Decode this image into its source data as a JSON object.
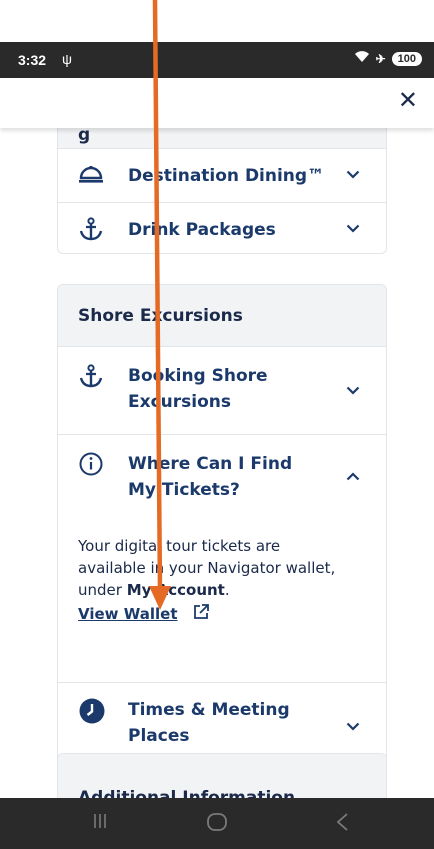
{
  "status_bar": {
    "time": "3:32",
    "usb_icon": "usb-icon",
    "wifi_icon": "wifi-icon",
    "airplane_icon": "airplane-icon",
    "battery": "100"
  },
  "header": {
    "close_icon": "close-icon"
  },
  "sections": {
    "dining": {
      "title_partial": "g",
      "items": [
        {
          "label": "Destination Dining™",
          "icon": "cloche-icon"
        },
        {
          "label": "Drink Packages",
          "icon": "anchor-icon"
        }
      ]
    },
    "shore_excursions": {
      "title": "Shore Excursions",
      "items": [
        {
          "label_line1": "Booking Shore",
          "label_line2": "Excursions",
          "icon": "anchor-icon"
        },
        {
          "label_line1": "Where Can I Find",
          "label_line2": "My Tickets?",
          "icon": "info-icon"
        },
        {
          "label_line1": "Times & Meeting",
          "label_line2": "Places",
          "icon": "clock-icon"
        }
      ],
      "faq_answer": {
        "line1": "Your digital tour tickets are",
        "line2": "available in your Navigator wallet,",
        "line3_prefix": "under ",
        "line3_bold": "My Account",
        "line3_suffix": ".",
        "link": "View Wallet"
      }
    },
    "additional": {
      "title": "Additional Information"
    }
  },
  "nav_bar": {
    "recents_icon": "recents-icon",
    "home_icon": "home-icon",
    "back_icon": "back-icon"
  },
  "colors": {
    "annotation_arrow": "#e56a24",
    "brand_navy": "#1b3a6b",
    "status_bar_bg": "#2a2a2a"
  }
}
